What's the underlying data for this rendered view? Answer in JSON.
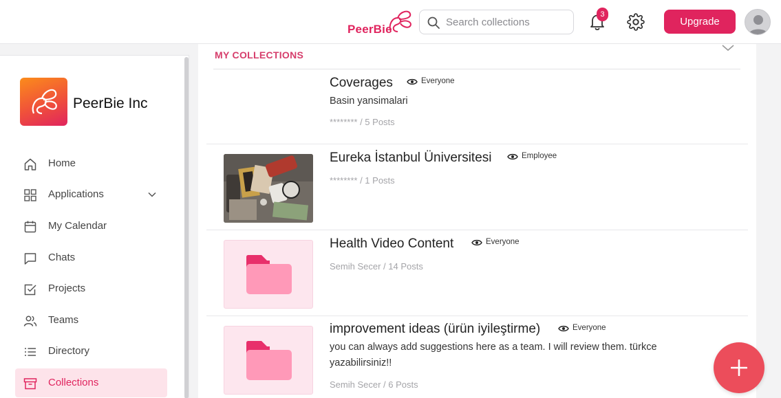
{
  "header": {
    "brand": "PeerBie",
    "search_placeholder": "Search collections",
    "notification_count": "3",
    "upgrade_label": "Upgrade"
  },
  "sidebar": {
    "org_name": "PeerBie Inc",
    "items": [
      {
        "label": "Home",
        "icon": "home-icon"
      },
      {
        "label": "Applications",
        "icon": "grid-icon"
      },
      {
        "label": "My Calendar",
        "icon": "calendar-icon"
      },
      {
        "label": "Chats",
        "icon": "chat-icon"
      },
      {
        "label": "Projects",
        "icon": "checkbox-icon"
      },
      {
        "label": "Teams",
        "icon": "users-icon"
      },
      {
        "label": "Directory",
        "icon": "list-icon"
      },
      {
        "label": "Collections",
        "icon": "archive-icon",
        "active": true
      }
    ]
  },
  "main": {
    "section_title": "MY COLLECTIONS",
    "collections": [
      {
        "title": "Coverages",
        "visibility": "Everyone",
        "description": "Basin yansimalari",
        "meta": "******** / 5 Posts",
        "thumbnail": "none"
      },
      {
        "title": "Eureka İstanbul Üniversitesi",
        "visibility": "Employee",
        "description": "",
        "meta": "******** / 1 Posts",
        "thumbnail": "photo"
      },
      {
        "title": "Health Video Content",
        "visibility": "Everyone",
        "description": "",
        "meta": "Semih Secer / 14 Posts",
        "thumbnail": "folder-icon"
      },
      {
        "title": "improvement ideas (ürün iyileştirme)",
        "visibility": "Everyone",
        "description": "you can always add suggestions here as a team. I will review them. türkce yazabilirsiniz!!",
        "meta": "Semih Secer / 6 Posts",
        "thumbnail": "folder-icon"
      }
    ]
  },
  "colors": {
    "accent": "#e0245e",
    "fab": "#ec4d5b",
    "active_nav_bg": "#fde3ea",
    "folder_bg": "#fde6ee"
  }
}
